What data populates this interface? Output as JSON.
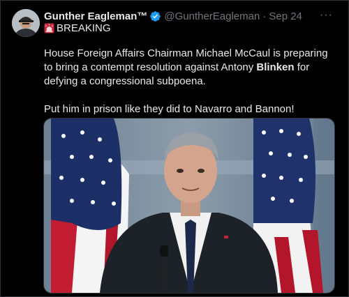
{
  "tweet": {
    "display_name": "Gunther Eagleman™",
    "handle": "@GuntherEagleman",
    "separator": "·",
    "date": "Sep 24",
    "breaking_label": "BREAKING",
    "line1_before": "House Foreign Affairs Chairman Michael McCaul is preparing to bring a contempt resolution against Antony ",
    "line1_bold": "Blinken",
    "line1_after": " for defying a congressional subpoena.",
    "line2": "Put him in prison like they did to Navarro and Bannon!",
    "more_label": "···"
  },
  "icons": {
    "verified": "verified-badge-icon",
    "siren": "siren-emoji-icon",
    "more": "more-options-icon"
  },
  "colors": {
    "background": "#000000",
    "text": "#e7e9ea",
    "secondary": "#71767b",
    "verified_blue": "#1d9bf0",
    "siren_red": "#e0245e"
  }
}
